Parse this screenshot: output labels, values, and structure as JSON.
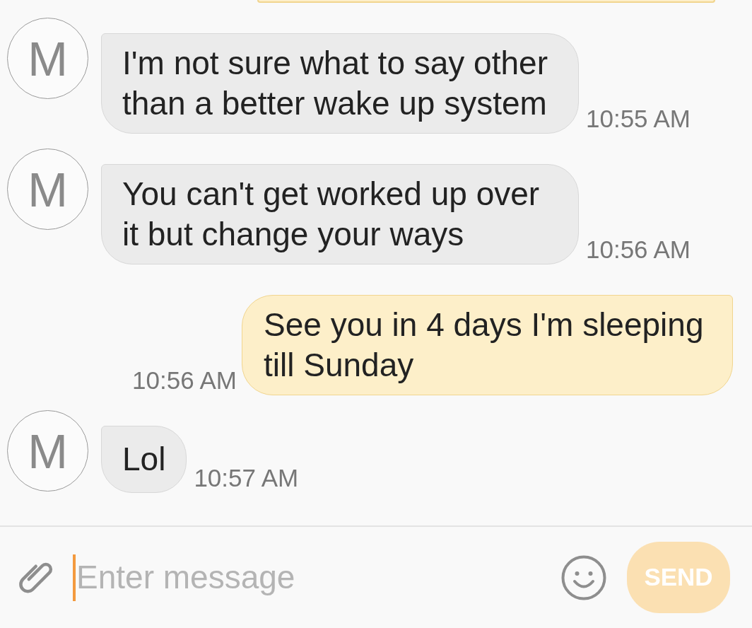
{
  "messages": [
    {
      "kind": "outgoing",
      "clipped": true
    },
    {
      "kind": "incoming",
      "clipped": false,
      "avatar": "M",
      "text": "I'm not sure what to say other than a better wake up system",
      "time": "10:55 AM"
    },
    {
      "kind": "incoming",
      "clipped": false,
      "avatar": "M",
      "text": "You can't get worked up over it but change your ways",
      "time": "10:56 AM"
    },
    {
      "kind": "outgoing",
      "clipped": false,
      "text": "See you in 4 days I'm sleeping till Sunday",
      "time": "10:56 AM"
    },
    {
      "kind": "incoming",
      "clipped": false,
      "avatar": "M",
      "text": "Lol",
      "time": "10:57 AM"
    }
  ],
  "composer": {
    "placeholder": "Enter message",
    "send_button": {
      "label": "SEND",
      "disabled": true
    }
  }
}
